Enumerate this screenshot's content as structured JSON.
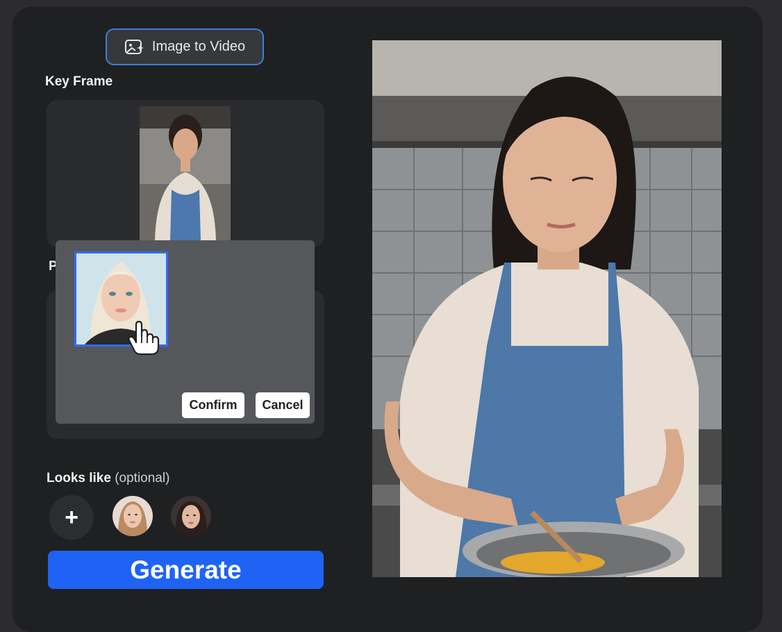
{
  "mode_button": {
    "label": "Image to Video",
    "icon": "image-sparkle-icon"
  },
  "key_frame": {
    "title": "Key Frame"
  },
  "hidden_section": {
    "label_fragment": "P"
  },
  "popup": {
    "confirm_label": "Confirm",
    "cancel_label": "Cancel"
  },
  "looks_like": {
    "title": "Looks like",
    "optional": "(optional)",
    "add_label": "+"
  },
  "generate": {
    "label": "Generate"
  },
  "colors": {
    "accent": "#1f63f5",
    "selection_border": "#2f6bff",
    "mode_border": "#3f7fd8",
    "panel": "#1f2022"
  }
}
